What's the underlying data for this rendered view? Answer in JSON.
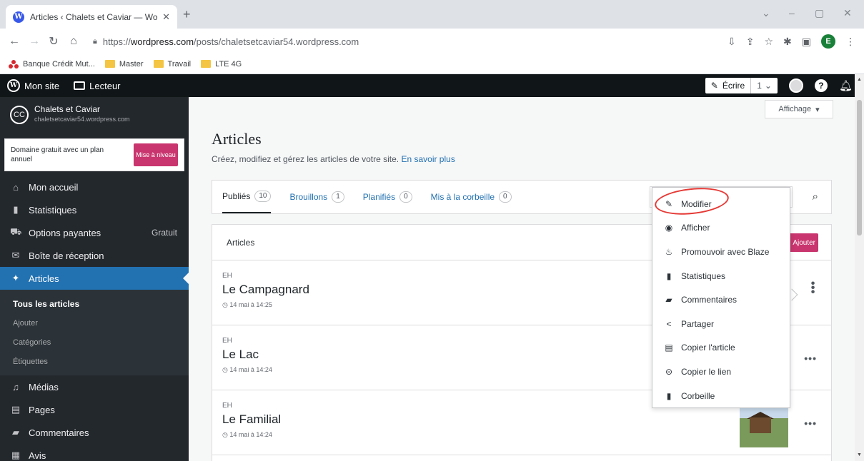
{
  "browser": {
    "tab_title": "Articles ‹ Chalets et Caviar — Wo",
    "tab_close": "✕",
    "new_tab": "+",
    "url_prefix": "https://",
    "url_host": "wordpress.com",
    "url_path": "/posts/chaletsetcaviar54.wordpress.com",
    "profile_letter": "E",
    "bookmarks": [
      "Banque Crédit Mut...",
      "Master",
      "Travail",
      "LTE 4G"
    ]
  },
  "adminbar": {
    "my_site": "Mon site",
    "reader": "Lecteur",
    "write": "Écrire",
    "write_count": "1"
  },
  "sidebar": {
    "site_initials": "CC",
    "site_name": "Chalets et Caviar",
    "site_url": "chaletsetcaviar54.wordpress.com",
    "upgrade_text": "Domaine gratuit avec un plan annuel",
    "upgrade_button": "Mise à niveau",
    "items": [
      {
        "label": "Mon accueil"
      },
      {
        "label": "Statistiques"
      },
      {
        "label": "Options payantes",
        "badge": "Gratuit"
      },
      {
        "label": "Boîte de réception"
      },
      {
        "label": "Articles"
      }
    ],
    "submenu": [
      "Tous les articles",
      "Ajouter",
      "Catégories",
      "Étiquettes"
    ],
    "items_after": [
      {
        "label": "Médias"
      },
      {
        "label": "Pages"
      },
      {
        "label": "Commentaires"
      },
      {
        "label": "Avis"
      }
    ]
  },
  "main": {
    "view_button": "Affichage",
    "title": "Articles",
    "subtitle": "Créez, modifiez et gérez les articles de votre site.",
    "learn_more": "En savoir plus",
    "tabs": [
      {
        "label": "Publiés",
        "count": "10"
      },
      {
        "label": "Brouillons",
        "count": "1"
      },
      {
        "label": "Planifiés",
        "count": "0"
      },
      {
        "label": "Mis à la corbeille",
        "count": "0"
      }
    ],
    "list_header": "Articles",
    "add_button": "Ajouter",
    "posts": [
      {
        "author": "EH",
        "title": "Le Campagnard",
        "date": "14 mai à 14:25"
      },
      {
        "author": "EH",
        "title": "Le Lac",
        "date": "14 mai à 14:24"
      },
      {
        "author": "EH",
        "title": "Le Familial",
        "date": "14 mai à 14:24"
      }
    ]
  },
  "popover": {
    "items": [
      "Modifier",
      "Afficher",
      "Promouvoir avec Blaze",
      "Statistiques",
      "Commentaires",
      "Partager",
      "Copier l'article",
      "Copier le lien",
      "Corbeille"
    ]
  },
  "colors": {
    "admin_bar": "#101517",
    "sidebar": "#23282d",
    "active_menu": "#2271b1",
    "accent_pink": "#c9356e",
    "highlight_red": "#e53935"
  }
}
